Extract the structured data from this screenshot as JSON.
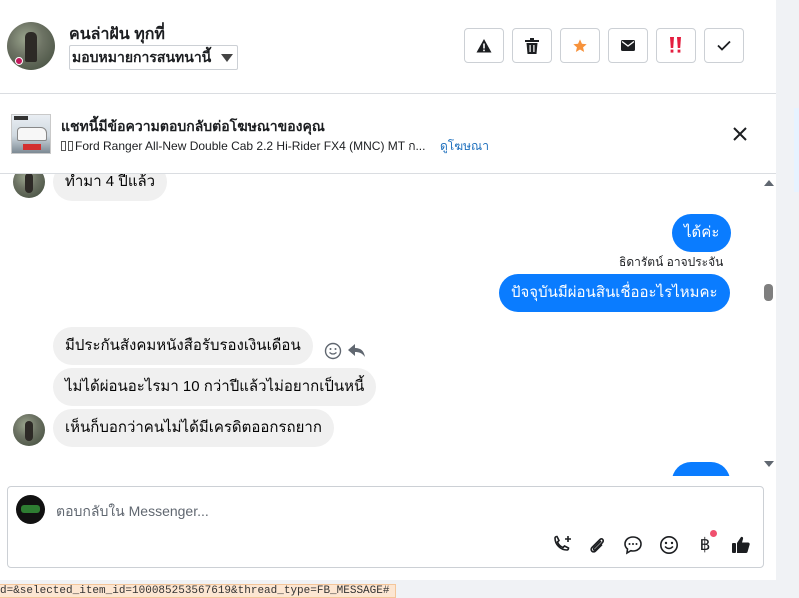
{
  "header": {
    "contact_name": "คนล่าฝัน ทุกที่",
    "assign_label": "มอบหมายการสนทนานี้",
    "actions": [
      {
        "name": "report-button",
        "icon": "warning-icon"
      },
      {
        "name": "delete-button",
        "icon": "trash-icon"
      },
      {
        "name": "star-button",
        "icon": "star-icon",
        "color": "#f7923b"
      },
      {
        "name": "mark-unread-button",
        "icon": "envelope-icon"
      },
      {
        "name": "spam-button",
        "icon": "double-exclamation-icon",
        "color": "#e41e3f"
      },
      {
        "name": "done-button",
        "icon": "check-icon"
      }
    ]
  },
  "ad": {
    "title": "แชทนี้มีข้อความตอบกลับต่อโฆษณาของคุณ",
    "subtitle": "Ford Ranger All-New Double Cab 2.2 Hi-Rider FX4 (MNC) MT ก...",
    "link": "ดูโฆษณา"
  },
  "messages": [
    {
      "from": "contact",
      "text": "ทำมา 4 ปีแล้ว"
    },
    {
      "from": "page",
      "text": "ได้ค่ะ"
    },
    {
      "from": "page",
      "sender": "ธิดารัตน์ อาจประจัน",
      "text": "ปัจจุบันมีผ่อนสินเชื่ออะไรไหมคะ"
    },
    {
      "from": "contact",
      "text": "มีประกันสังคมหนังสือรับรองเงินเดือน"
    },
    {
      "from": "contact",
      "text": "ไม่ได้ผ่อนอะไรมา 10 กว่าปีแล้วไม่อยากเป็นหนี้"
    },
    {
      "from": "contact",
      "text": "เห็นก็บอกว่าคนไม่ได้มีเครดิตออกรถยาก"
    }
  ],
  "composer": {
    "placeholder": "ตอบกลับใน Messenger...",
    "currency_symbol": "฿"
  },
  "url_fragment": "d=&selected_item_id=100085253567619&thread_type=FB_MESSAGE#",
  "colors": {
    "bubble_out": "#0a7cff",
    "bubble_in": "#f0f0f0",
    "link": "#1d6fbd"
  }
}
